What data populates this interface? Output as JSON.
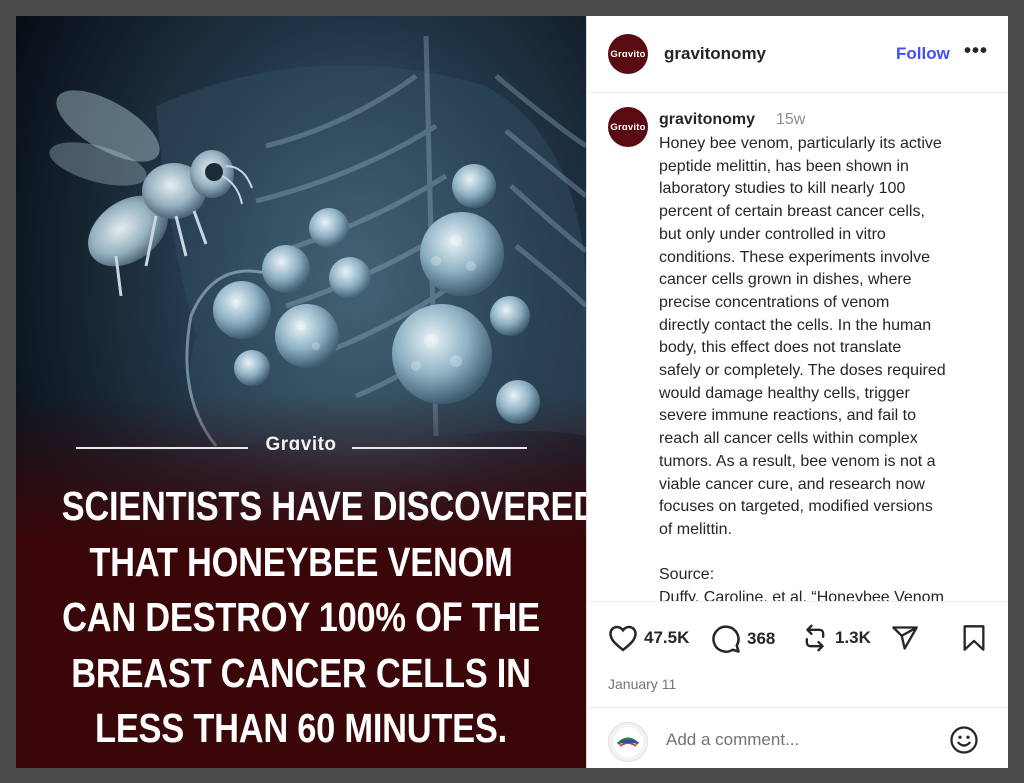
{
  "media": {
    "brand": "Grɑvito",
    "headline_lines": [
      "SCIENTISTS HAVE DISCOVERED",
      "THAT HONEYBEE VENOM",
      "CAN DESTROY 100% OF THE",
      "BREAST CANCER CELLS IN",
      "LESS THAN 60 MINUTES."
    ]
  },
  "header": {
    "avatar_text": "Grɑvito",
    "username": "gravitonomy",
    "follow_label": "Follow",
    "more_label": "•••"
  },
  "caption": {
    "avatar_text": "Grɑvito",
    "username": "gravitonomy",
    "time": "15w",
    "text": "Honey bee venom, particularly its active\npeptide melittin, has been shown in\nlaboratory studies to kill nearly 100\npercent of certain breast cancer cells,\nbut only under controlled in vitro\nconditions. These experiments involve\ncancer cells grown in dishes, where\nprecise concentrations of venom\ndirectly contact the cells. In the human\nbody, this effect does not translate\nsafely or completely. The doses required\nwould damage healthy cells, trigger\nsevere immune reactions, and fail to\nreach all cancer cells within complex\ntumors. As a result, bee venom is not a\nviable cancer cure, and research now\nfocuses on targeted, modified versions\nof melittin.\n\nSource:\nDuffy, Caroline, et al. “Honeybee Venom"
  },
  "actions": {
    "likes": "47.5K",
    "comments": "368",
    "reposts": "1.3K",
    "date": "January 11"
  },
  "comment_bar": {
    "placeholder": "Add a comment..."
  },
  "icons": {
    "like": "heart-icon",
    "comment": "speech-bubble-icon",
    "repost": "repost-icon",
    "share": "paper-plane-icon",
    "save": "bookmark-icon",
    "emoji": "smiley-icon"
  },
  "colors": {
    "accent": "#4150f7",
    "avatar_bg": "#5a0b12",
    "headline_bg": "#3a0608"
  }
}
